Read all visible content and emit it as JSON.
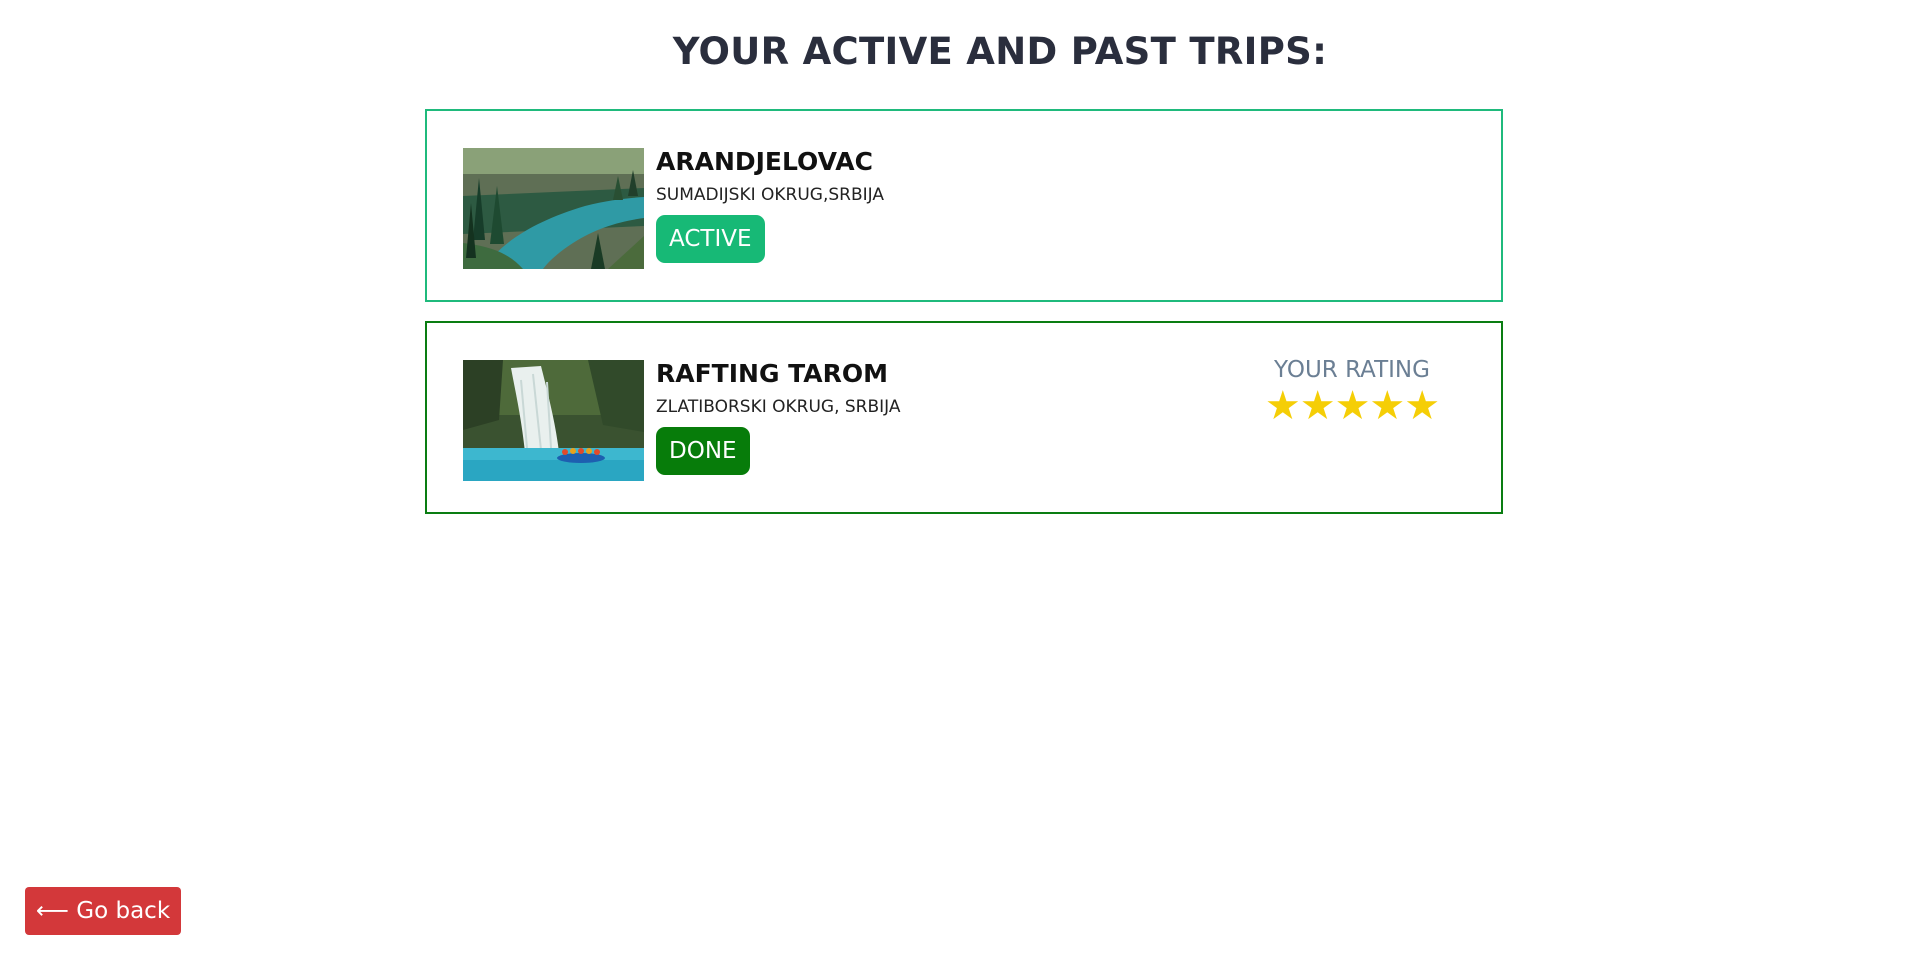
{
  "page": {
    "title": "YOUR ACTIVE AND PAST TRIPS:"
  },
  "trips": [
    {
      "name": "ARANDJELOVAC",
      "location": "SUMADIJSKI OKRUG,SRBIJA",
      "status": "ACTIVE",
      "status_color": "#17b976",
      "border_color": "#1fba7c",
      "image_icon": "lake-forest-photo"
    },
    {
      "name": "RAFTING TAROM",
      "location": "ZLATIBORSKI OKRUG, SRBIJA",
      "status": "DONE",
      "status_color": "#077c0a",
      "border_color": "#0a7d12",
      "image_icon": "waterfall-rafting-photo",
      "rating": {
        "label": "YOUR RATING",
        "stars": 5,
        "max_stars": 5,
        "star_color": "#f5ce06"
      }
    }
  ],
  "footer": {
    "back_label": "⟵ Go back",
    "back_color": "#d3383a"
  }
}
